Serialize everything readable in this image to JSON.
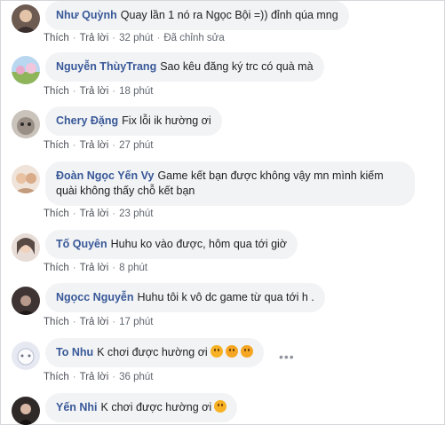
{
  "comments": [
    {
      "name": "Như Quỳnh",
      "text": "Quay lần 1 nó ra Ngọc Bội =)) đỉnh qúa mng",
      "like": "Thích",
      "reply": "Trả lời",
      "time": "32 phút",
      "edited": "Đã chỉnh sửa",
      "avatar_color": "#6d5b52"
    },
    {
      "name": "Nguyễn ThùyTrang",
      "text": "Sao kêu đăng ký trc có quà mà",
      "like": "Thích",
      "reply": "Trả lời",
      "time": "18 phút",
      "avatar_color": "#8fb55a"
    },
    {
      "name": "Chery Đặng",
      "text": "Fix lỗi ik hường ơi",
      "like": "Thích",
      "reply": "Trả lời",
      "time": "27 phút",
      "avatar_color": "#9a8f86"
    },
    {
      "name": "Đoàn Ngọc Yến Vy",
      "text": "Game kết bạn được không vậy mn mình kiếm quài không thấy chỗ kết bạn",
      "like": "Thích",
      "reply": "Trả lời",
      "time": "23 phút",
      "avatar_color": "#c49a7c"
    },
    {
      "name": "Tố Quyên",
      "text": "Huhu ko vào được, hôm qua tới giờ",
      "like": "Thích",
      "reply": "Trả lời",
      "time": "8 phút",
      "avatar_color": "#5a4a44"
    },
    {
      "name": "Ngọcc Nguyễn",
      "text": "Huhu tôi k vô dc game từ qua tới h .",
      "like": "Thích",
      "reply": "Trả lời",
      "time": "17 phút",
      "avatar_color": "#3e3433"
    },
    {
      "name": "To Nhu",
      "text": "K chơi được hường ơi",
      "like": "Thích",
      "reply": "Trả lời",
      "time": "36 phút",
      "avatar_color": "#e6e9f2",
      "emoji_count": 3
    },
    {
      "name": "Yến Nhi",
      "text": "K chơi được hường ơi",
      "avatar_color": "#2f2a28",
      "emoji_count": 1
    }
  ],
  "more_options": "•••"
}
